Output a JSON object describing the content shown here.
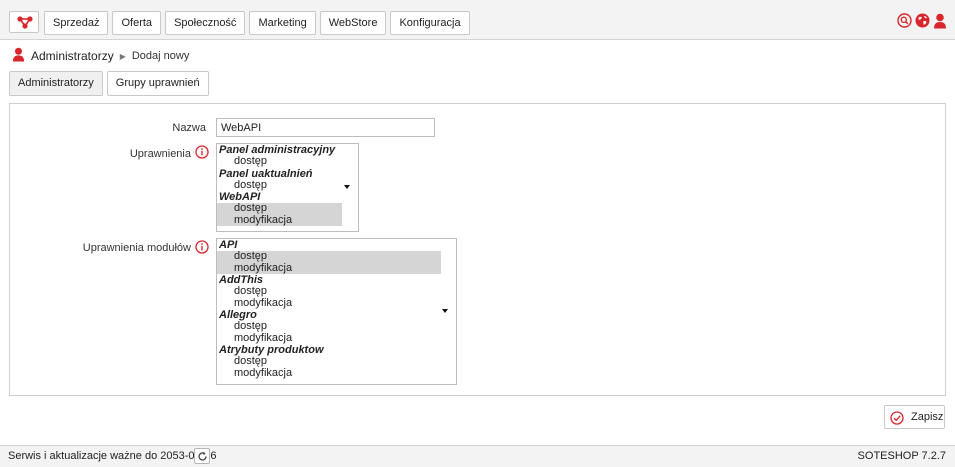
{
  "nav": {
    "items": [
      "Sprzedaż",
      "Oferta",
      "Społeczność",
      "Marketing",
      "WebStore",
      "Konfiguracja"
    ]
  },
  "breadcrumb": {
    "title": "Administratorzy",
    "current": "Dodaj nowy"
  },
  "tabs": [
    "Administratorzy",
    "Grupy uprawnień"
  ],
  "form": {
    "name_label": "Nazwa",
    "name_value": "WebAPI",
    "permissions_label": "Uprawnienia",
    "permissions": [
      {
        "group": "Panel administracyjny",
        "options": [
          {
            "label": "dostęp",
            "selected": false
          }
        ]
      },
      {
        "group": "Panel uaktualnień",
        "options": [
          {
            "label": "dostęp",
            "selected": false
          }
        ]
      },
      {
        "group": "WebAPI",
        "options": [
          {
            "label": "dostęp",
            "selected": true
          },
          {
            "label": "modyfikacja",
            "selected": true
          }
        ]
      }
    ],
    "module_permissions_label": "Uprawnienia modułów",
    "module_permissions": [
      {
        "group": "API",
        "options": [
          {
            "label": "dostęp",
            "selected": true
          },
          {
            "label": "modyfikacja",
            "selected": true
          }
        ]
      },
      {
        "group": "AddThis",
        "options": [
          {
            "label": "dostęp",
            "selected": false
          },
          {
            "label": "modyfikacja",
            "selected": false
          }
        ]
      },
      {
        "group": "Allegro",
        "options": [
          {
            "label": "dostęp",
            "selected": false
          },
          {
            "label": "modyfikacja",
            "selected": false
          }
        ]
      },
      {
        "group": "Atrybuty produktow",
        "options": [
          {
            "label": "dostęp",
            "selected": false
          },
          {
            "label": "modyfikacja",
            "selected": false
          }
        ]
      }
    ]
  },
  "actions": {
    "save_label": "Zapisz"
  },
  "footer": {
    "service_text": "Serwis i aktualizacje ważne do 2053-08-26",
    "version": "SOTESHOP 7.2.7"
  },
  "colors": {
    "accent_red": "#d9262c",
    "selection_gray": "#d5d5d5"
  },
  "icons": {
    "logo": "network-logo-icon",
    "search": "search-icon",
    "globe": "globe-icon",
    "user": "user-icon",
    "info": "info-icon",
    "save": "check-circle-icon",
    "refresh": "refresh-icon"
  }
}
